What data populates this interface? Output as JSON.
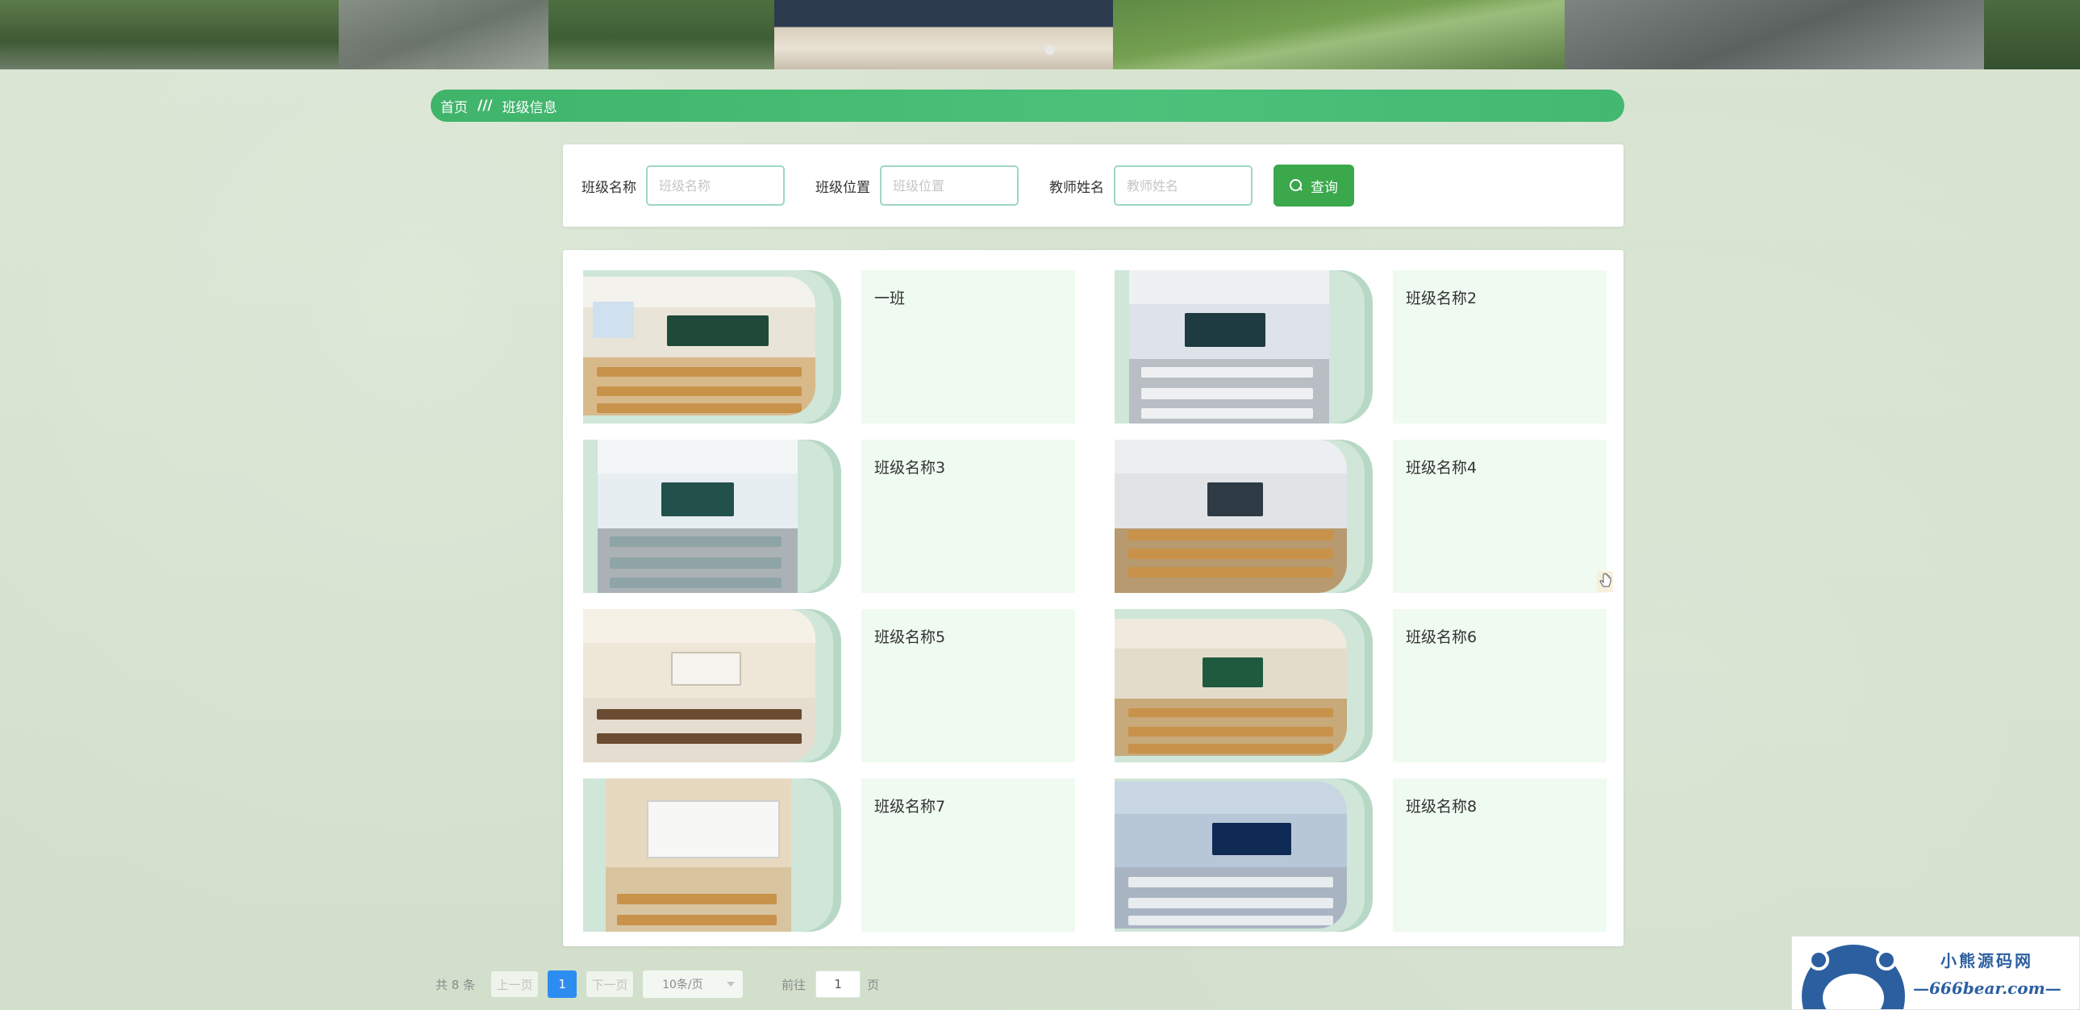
{
  "breadcrumb": {
    "home": "首页",
    "separator": "///",
    "current": "班级信息"
  },
  "search": {
    "fields": [
      {
        "label": "班级名称",
        "placeholder": "班级名称",
        "value": ""
      },
      {
        "label": "班级位置",
        "placeholder": "班级位置",
        "value": ""
      },
      {
        "label": "教师姓名",
        "placeholder": "教师姓名",
        "value": ""
      }
    ],
    "query_label": "查询"
  },
  "classes": [
    {
      "name": "一班"
    },
    {
      "name": "班级名称2"
    },
    {
      "name": "班级名称3"
    },
    {
      "name": "班级名称4"
    },
    {
      "name": "班级名称5"
    },
    {
      "name": "班级名称6"
    },
    {
      "name": "班级名称7"
    },
    {
      "name": "班级名称8"
    }
  ],
  "pagination": {
    "total_text": "共 8 条",
    "prev_label": "上一页",
    "current_page": "1",
    "next_label": "下一页",
    "page_size": "10条/页",
    "jump_prefix": "前往",
    "jump_value": "1",
    "jump_suffix": "页"
  },
  "watermark": {
    "title": "小熊源码网",
    "url": "—666bear.com—"
  },
  "colors": {
    "accent_green": "#3aa84b",
    "breadcrumb_green": "#43b870",
    "page_blue": "#2d8cf0",
    "card_info_bg": "#effaf0"
  }
}
